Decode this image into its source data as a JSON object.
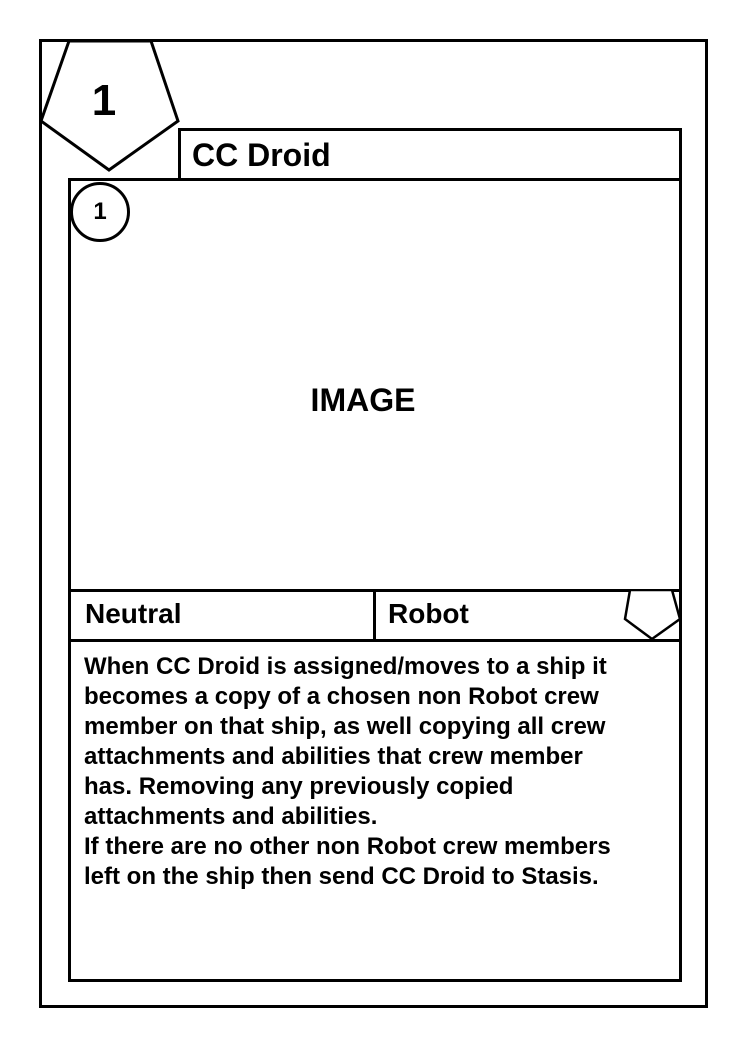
{
  "card": {
    "cost": "1",
    "name": "CC Droid",
    "image_placeholder": "IMAGE",
    "power": "1",
    "faction": "Neutral",
    "type": "Robot",
    "ability_text": "When CC Droid is assigned/moves to a ship it\nbecomes a copy of a chosen non Robot crew\nmember on that ship, as well copying all crew\nattachments and abilities that crew member\nhas. Removing any previously copied\nattachments and abilities.\nIf there are no other non Robot crew members\nleft on the ship then send CC Droid to Stasis."
  },
  "colors": {
    "background": "#ffffff",
    "line": "#000000"
  },
  "icons": {
    "cost": "pentagon-icon",
    "power": "circle-icon",
    "type_marker": "pentagon-icon"
  }
}
